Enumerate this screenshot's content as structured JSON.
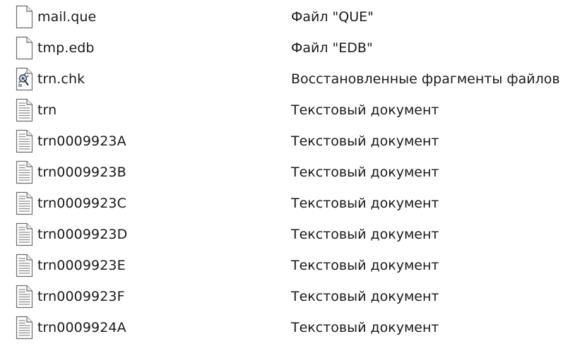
{
  "files": [
    {
      "name": "mail.que",
      "type": "Файл \"QUE\"",
      "icon": "blank-file-icon"
    },
    {
      "name": "tmp.edb",
      "type": "Файл \"EDB\"",
      "icon": "blank-file-icon"
    },
    {
      "name": "trn.chk",
      "type": "Восстановленные фрагменты файлов",
      "icon": "recovered-fragment-icon"
    },
    {
      "name": "trn",
      "type": "Текстовый документ",
      "icon": "text-document-icon"
    },
    {
      "name": "trn0009923A",
      "type": "Текстовый документ",
      "icon": "text-document-icon"
    },
    {
      "name": "trn0009923B",
      "type": "Текстовый документ",
      "icon": "text-document-icon"
    },
    {
      "name": "trn0009923C",
      "type": "Текстовый документ",
      "icon": "text-document-icon"
    },
    {
      "name": "trn0009923D",
      "type": "Текстовый документ",
      "icon": "text-document-icon"
    },
    {
      "name": "trn0009923E",
      "type": "Текстовый документ",
      "icon": "text-document-icon"
    },
    {
      "name": "trn0009923F",
      "type": "Текстовый документ",
      "icon": "text-document-icon"
    },
    {
      "name": "trn0009924A",
      "type": "Текстовый документ",
      "icon": "text-document-icon"
    }
  ]
}
